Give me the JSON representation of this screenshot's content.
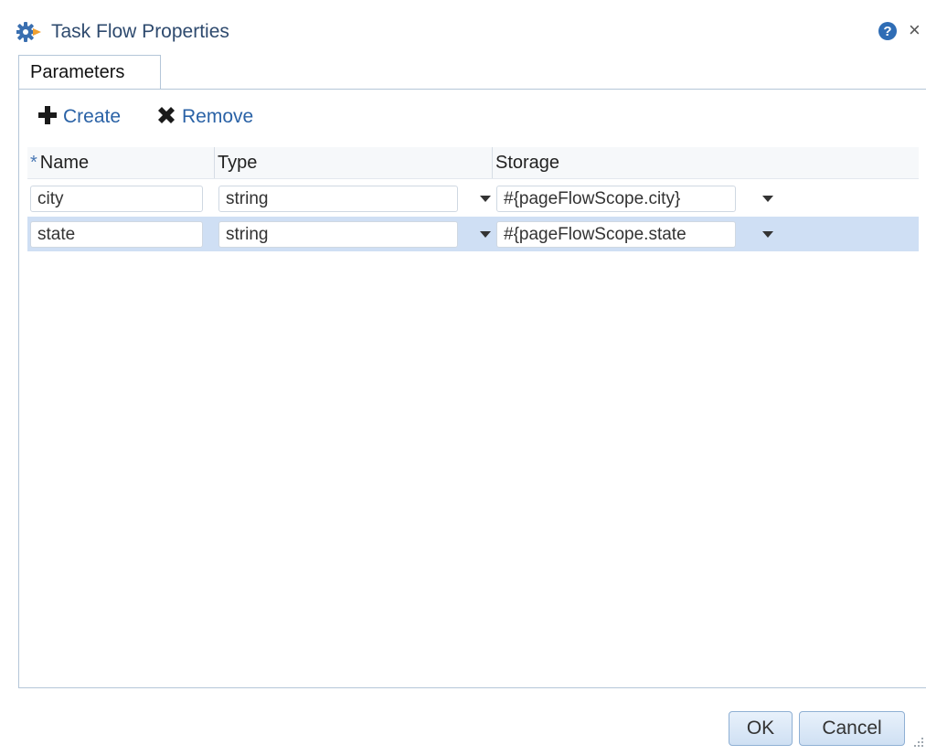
{
  "dialog": {
    "title": "Task Flow Properties",
    "icons": {
      "title": "gear-flow-icon",
      "help": "help-icon",
      "close": "close-icon"
    }
  },
  "tabs": [
    {
      "label": "Parameters",
      "selected": true
    }
  ],
  "toolbar": {
    "create_label": "Create",
    "remove_label": "Remove",
    "create_icon": "plus-icon",
    "remove_icon": "x-icon"
  },
  "table": {
    "columns": [
      {
        "label": "Name",
        "required": true,
        "required_mark": "*"
      },
      {
        "label": "Type"
      },
      {
        "label": "Storage"
      }
    ],
    "rows": [
      {
        "name": "city",
        "type": "string",
        "storage": "#{pageFlowScope.city}",
        "selected": false
      },
      {
        "name": "state",
        "type": "string",
        "storage": "#{pageFlowScope.state",
        "selected": true
      }
    ]
  },
  "footer": {
    "ok_label": "OK",
    "cancel_label": "Cancel"
  },
  "colors": {
    "title": "#2e4a6e",
    "link": "#2a62a6",
    "selected_row": "#cfdff4",
    "button_border": "#8fb0d4"
  }
}
